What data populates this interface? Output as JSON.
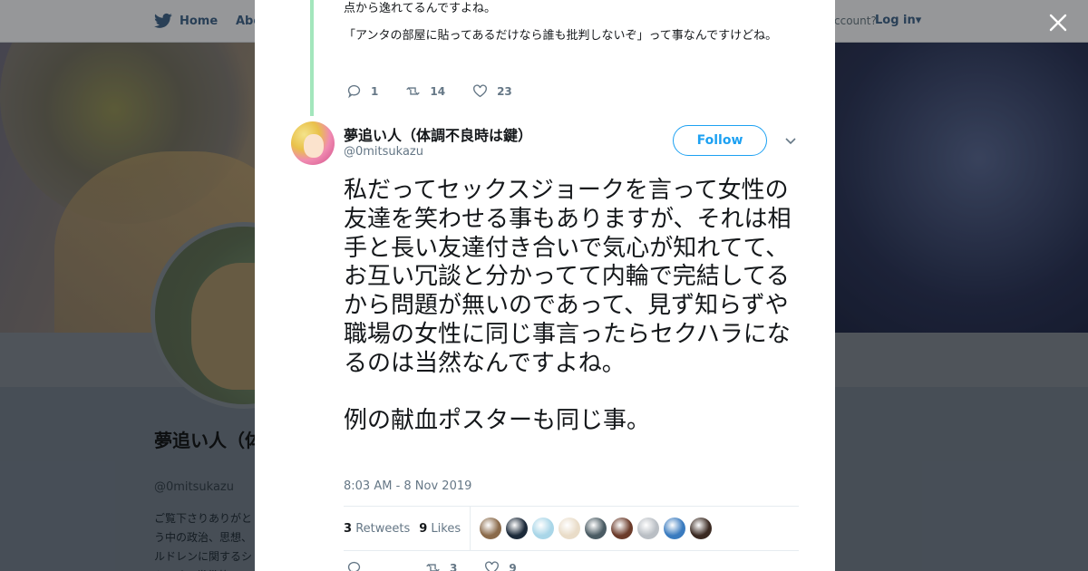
{
  "topbar": {
    "home_label": "Home",
    "about_label": "Abo",
    "account_text": "ccount?",
    "login_label": "Log in"
  },
  "profile": {
    "name": "夢追い人（体調不良時は鍵）",
    "handle": "@0mitsukazu",
    "bio": "ご覧下さりありがとう中の政治、思想、ルドレンに関するシトです。世俗的"
  },
  "previous_tweet": {
    "lines": [
      "点から逸れてるんですよね。",
      "「アンタの部屋に貼ってあるだけなら誰も批判しないぞ」って事なんですけどね。"
    ],
    "reply_count": "1",
    "retweet_count": "14",
    "like_count": "23"
  },
  "tweet": {
    "author_name": "夢追い人（体調不良時は鍵）",
    "author_handle": "@0mitsukazu",
    "follow_label": "Follow",
    "paragraph1": "私だってセックスジョークを言って女性の友達を笑わせる事もありますが、それは相手と長い友達付き合いで気心が知れてて、お互い冗談と分かってて内輪で完結してるから問題が無いのであって、見ず知らずや職場の女性に同じ事言ったらセクハラになるのは当然なんですよね。",
    "paragraph2": "例の献血ポスターも同じ事。",
    "timestamp": "8:03 AM - 8 Nov 2019",
    "retweets_count": "3",
    "retweets_label": "Retweets",
    "likes_count": "9",
    "likes_label": "Likes",
    "bottom_retweet_count": "3",
    "bottom_like_count": "9"
  },
  "likers": [
    {
      "color": "#8a6a4a"
    },
    {
      "color": "#1c2a3a"
    },
    {
      "color": "#a9d6e8"
    },
    {
      "color": "#e9dcc8"
    },
    {
      "color": "#4a5b63"
    },
    {
      "color": "#6b3b2a"
    },
    {
      "color": "#b9bec4"
    },
    {
      "color": "#3a7bbf"
    },
    {
      "color": "#3b2a22"
    }
  ],
  "colors": {
    "accent": "#1da1f2",
    "thread_line": "#a3e6bc",
    "muted_text": "#657786"
  }
}
